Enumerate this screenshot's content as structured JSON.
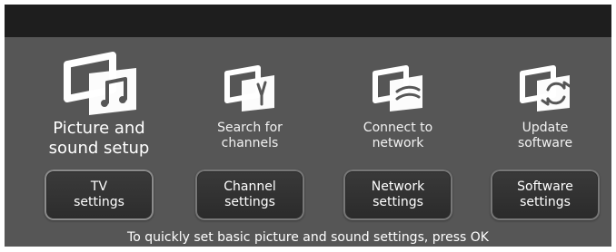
{
  "items": [
    {
      "title_line1": "Picture and",
      "title_line2": "sound setup",
      "button_line1": "TV",
      "button_line2": "settings",
      "icon": "picture-sound-icon"
    },
    {
      "title_line1": "Search for",
      "title_line2": "channels",
      "button_line1": "Channel",
      "button_line2": "settings",
      "icon": "antenna-icon"
    },
    {
      "title_line1": "Connect to",
      "title_line2": "network",
      "button_line1": "Network",
      "button_line2": "settings",
      "icon": "network-icon"
    },
    {
      "title_line1": "Update",
      "title_line2": "software",
      "button_line1": "Software",
      "button_line2": "settings",
      "icon": "software-update-icon"
    }
  ],
  "footer": {
    "hint": "To quickly set basic picture and sound settings, press OK"
  },
  "colors": {
    "background": "#565656",
    "topbar": "#1e1e1e",
    "button": "#2f2f2f",
    "text": "#ffffff"
  }
}
